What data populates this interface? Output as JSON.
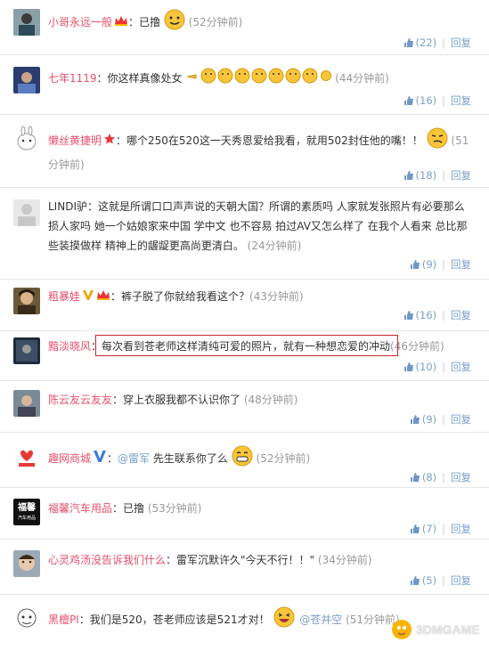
{
  "comments": [
    {
      "user": "小哥永远一般",
      "text": "：已撸",
      "time": "(52分钟前)",
      "likes": "(22)",
      "reply": "回复"
    },
    {
      "user": "七年1119",
      "text": "：你这样真像处女",
      "time": "(44分钟前)",
      "likes": "(16)",
      "reply": "回复"
    },
    {
      "user": "懒丝黄捷明",
      "text": "：哪个250在520这一天秀恩爱给我看，就用502封住他的嘴！！",
      "time": "(51分钟前)",
      "likes": "(18)",
      "reply": "回复"
    },
    {
      "user": "LINDI驴",
      "text": "：这就是所谓口口声声说的天朝大国？所谓的素质吗 人家就发张照片有必要那么损人家吗 她一个姑娘家来中国 学中文 也不容易 拍过AV又怎么样了 在我个人看来 总比那些装摸做样 精神上的龌龊更高尚更清白。",
      "time": "(24分钟前)",
      "likes": "(9)",
      "reply": "回复"
    },
    {
      "user": "粗暴娃",
      "text": "：裤子脱了你就给我看这个？",
      "time": "(43分钟前)",
      "likes": "(16)",
      "reply": "回复"
    },
    {
      "user": "黯淡晓风",
      "text": "：每次看到苍老师这样清纯可爱的照片，就有一种想恋爱的冲动",
      "time": "(46分钟前)",
      "likes": "(10)",
      "reply": "回复"
    },
    {
      "user": "陈云友云友友",
      "text": "：穿上衣服我都不认识你了",
      "time": "(48分钟前)",
      "likes": "(9)",
      "reply": "回复"
    },
    {
      "user": "趣网商城",
      "text": "：",
      "mention": "@雷军",
      "text2": " 先生联系你了么",
      "time": "(52分钟前)",
      "likes": "(8)",
      "reply": "回复"
    },
    {
      "user": "福馨汽车用品",
      "text": "：已撸",
      "time": "(53分钟前)",
      "likes": "(7)",
      "reply": "回复"
    },
    {
      "user": "心灵鸡汤没告诉我们什么",
      "text": "：雷军沉默许久\"今天不行！！\"",
      "time": "(34分钟前)",
      "likes": "(5)",
      "reply": "回复"
    },
    {
      "user": "黑檀PI",
      "text": "：我们是520，苍老师应该是521才对！",
      "mention": "@苍井空",
      "time": "(51分钟前)",
      "likes": "(5)",
      "reply": "回复"
    }
  ],
  "avatar4_text": "福馨",
  "avatar4_sub": "汽车用品",
  "watermark": "3DMGAME"
}
